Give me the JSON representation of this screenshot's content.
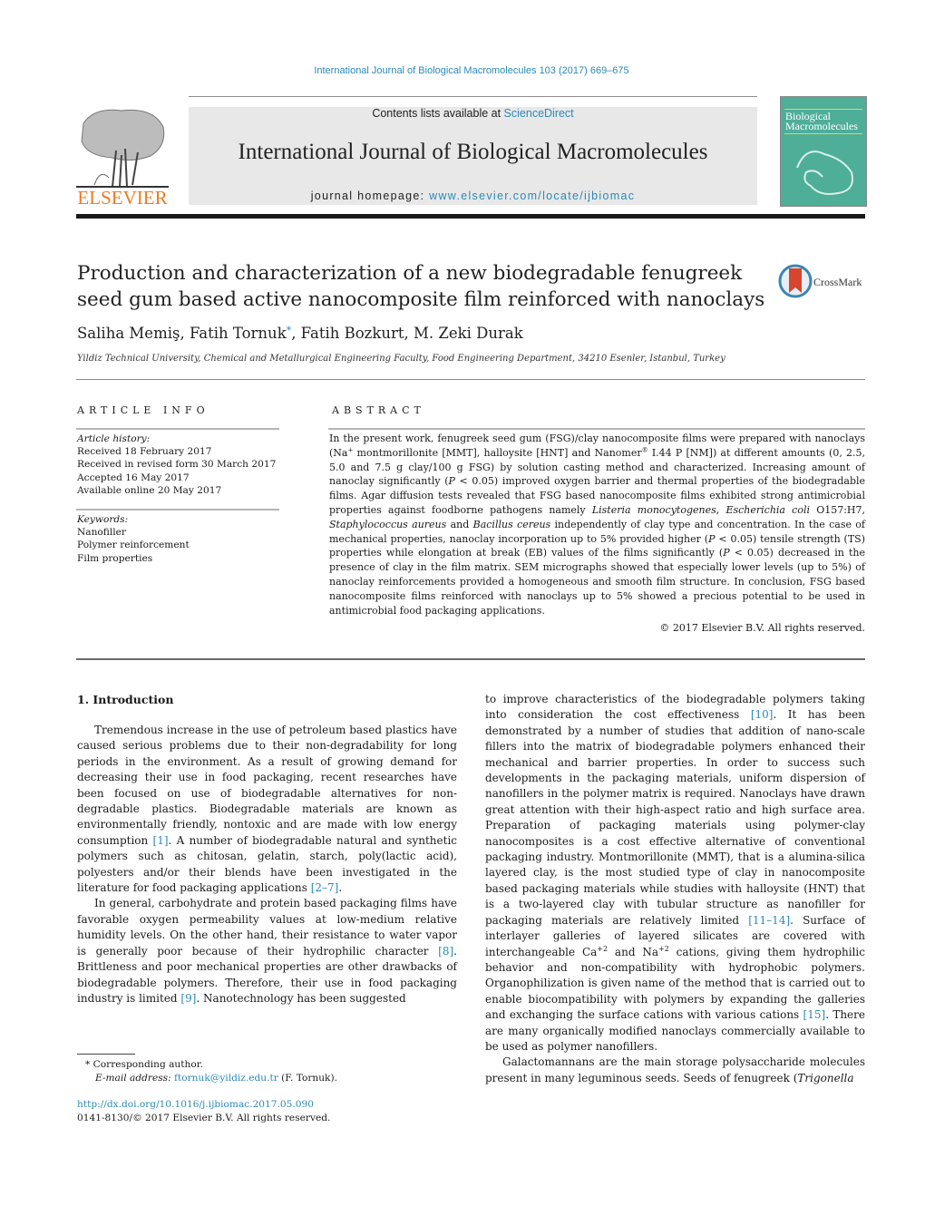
{
  "header": {
    "citation": "International Journal of Biological Macromolecules 103 (2017) 669–675",
    "contents_prefix": "Contents lists available at ",
    "contents_link": "ScienceDirect",
    "journal_name": "International Journal of Biological Macromolecules",
    "homepage_prefix": "journal homepage: ",
    "homepage_link": "www.elsevier.com/locate/ijbiomac",
    "publisher_logo": "ELSEVIER",
    "cover_title_line1": "Biological",
    "cover_title_line2": "Macromolecules",
    "crossmark_label": "CrossMark"
  },
  "article": {
    "title": "Production and characterization of a new biodegradable fenugreek seed gum based active nanocomposite film reinforced with nanoclays",
    "authors_pre": "Saliha Memiş, Fatih Tornuk",
    "author_mark": "*",
    "authors_post": ", Fatih Bozkurt, M. Zeki Durak",
    "affiliation": "Yildiz Technical University, Chemical and Metallurgical Engineering Faculty, Food Engineering Department, 34210 Esenler, Istanbul, Turkey"
  },
  "article_info": {
    "heading": "ARTICLE INFO",
    "history_label": "Article history:",
    "history": [
      "Received 18 February 2017",
      "Received in revised form 30 March 2017",
      "Accepted 16 May 2017",
      "Available online 20 May 2017"
    ],
    "keywords_label": "Keywords:",
    "keywords": [
      "Nanofiller",
      "Polymer reinforcement",
      "Film properties"
    ]
  },
  "abstract": {
    "heading": "ABSTRACT",
    "s1": "In the present work, fenugreek seed gum (FSG)/clay nanocomposite films were prepared with nanoclays (Na",
    "s1_sup": "+",
    "s2": " montmorillonite [MMT], halloysite [HNT] and Nanomer",
    "s2_sup": "®",
    "s3": " I.44 P [NM]) at different amounts (0, 2.5, 5.0 and 7.5 g clay/100 g FSG) by solution casting method and characterized. Increasing amount of nanoclay significantly (",
    "p1": "P",
    "s4": " < 0.05) improved oxygen barrier and thermal properties of the biodegradable films. Agar diffusion tests revealed that FSG based nanocomposite films exhibited strong antimicrobial properties against foodborne pathogens namely ",
    "sp1": "Listeria monocytogenes",
    "s5": ", ",
    "sp2": "Escherichia coli",
    "s6": " O157:H7, ",
    "sp3": "Staphylococcus aureus",
    "s7": " and ",
    "sp4": "Bacillus cereus",
    "s8": " independently of clay type and concentration. In the case of mechanical properties, nanoclay incorporation up to 5% provided higher (",
    "p2": "P",
    "s9": " < 0.05) tensile strength (TS) properties while elongation at break (EB) values of the films significantly (",
    "p3": "P",
    "s10": " < 0.05) decreased in the presence of clay in the film matrix. SEM micrographs showed that especially lower levels (up to 5%) of nanoclay reinforcements provided a homogeneous and smooth film structure. In conclusion, FSG based nanocomposite films reinforced with nanoclays up to 5% showed a precious potential to be used in antimicrobial food packaging applications.",
    "copyright": "© 2017 Elsevier B.V. All rights reserved."
  },
  "body": {
    "section_heading": "1.  Introduction",
    "left_p1_a": "Tremendous increase in the use of petroleum based plastics have caused serious problems due to their non-degradability for long periods in the environment. As a result of growing demand for decreasing their use in food packaging, recent researches have been focused on use of biodegradable alternatives for non-degradable plastics. Biodegradable materials are known as environmentally friendly, nontoxic and are made with low energy consumption ",
    "ref1": "[1]",
    "left_p1_b": ". A number of biodegradable natural and synthetic polymers such as chitosan, gelatin, starch, poly(lactic acid), polyesters and/or their blends have been investigated in the literature for food packaging applications ",
    "ref2": "[2–7]",
    "left_p1_c": ".",
    "left_p2_a": "In general, carbohydrate and protein based packaging films have favorable oxygen permeability values at low-medium relative humidity levels. On the other hand, their resistance to water vapor is generally poor because of their hydrophilic character ",
    "ref3": "[8]",
    "left_p2_b": ". Brittleness and poor mechanical properties are other drawbacks of biodegradable polymers. Therefore, their use in food packaging industry is limited ",
    "ref4": "[9]",
    "left_p2_c": ". Nanotechnology has been suggested",
    "right_p1_a": "to improve characteristics of the biodegradable polymers taking into consideration the cost effectiveness ",
    "ref5": "[10]",
    "right_p1_b": ". It has been demonstrated by a number of studies that addition of nano-scale fillers into the matrix of biodegradable polymers enhanced their mechanical and barrier properties. In order to success such developments in the packaging materials, uniform dispersion of nanofillers in the polymer matrix is required. Nanoclays have drawn great attention with their high-aspect ratio and high surface area. Preparation of packaging materials using polymer-clay nanocomposites is a cost effective alternative of conventional packaging industry. Montmorillonite (MMT), that is a alumina-silica layered clay, is the most studied type of clay in nanocomposite based packaging materials while studies with halloysite (HNT) that is a two-layered clay with tubular structure as nanofiller for packaging materials are relatively limited ",
    "ref6": "[11–14]",
    "right_p1_c": ". Surface of interlayer galleries of layered silicates are covered with interchangeable Ca",
    "sup_ca": "+2",
    "right_p1_d": " and Na",
    "sup_na": "+2",
    "right_p1_e": " cations, giving them hydrophilic behavior and non-compatibility with hydrophobic polymers. Organophilization is given name of the method that is carried out to enable biocompatibility with polymers by expanding the galleries and exchanging the surface cations with various cations ",
    "ref7": "[15]",
    "right_p1_f": ". There are many organically modified nanoclays commercially available to be used as polymer nanofillers.",
    "right_p2_a": "Galactomannans are the main storage polysaccharide molecules present in many leguminous seeds. Seeds of fenugreek (",
    "right_p2_ital": "Trigonella"
  },
  "footnote": {
    "mark": "*",
    "corresponding": " Corresponding author.",
    "email_label": "E-mail address:",
    "email": "ftornuk@yildiz.edu.tr",
    "email_owner": " (F. Tornuk).",
    "doi": "http://dx.doi.org/10.1016/j.ijbiomac.2017.05.090",
    "issn_line": "0141-8130/© 2017 Elsevier B.V. All rights reserved."
  },
  "colors": {
    "link": "#2a8ab8",
    "elsevier_orange": "#f07a1e",
    "masthead_bg": "#e8e8e8",
    "cover_teal": "#4fae98"
  }
}
